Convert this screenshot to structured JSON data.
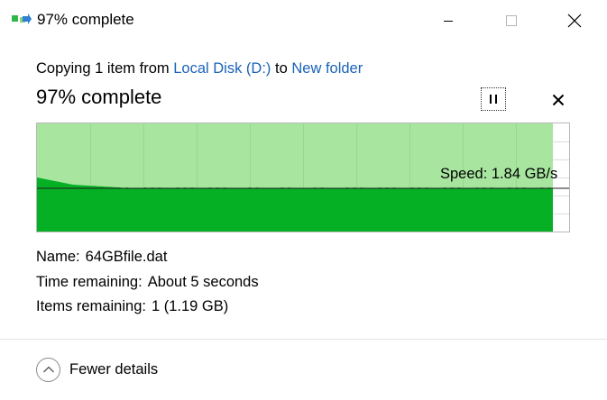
{
  "window": {
    "title": "97% complete"
  },
  "transfer": {
    "copying_prefix": "Copying 1 item from ",
    "source": "Local Disk (D:)",
    "to_word": " to ",
    "destination": "New folder",
    "percent_text": "97% complete",
    "progress_fraction": 0.97,
    "speed_text": "Speed: 1.84 GB/s"
  },
  "details": {
    "name_label": "Name:",
    "name_value": "64GBfile.dat",
    "time_label": "Time remaining:",
    "time_value": "About 5 seconds",
    "items_label": "Items remaining:",
    "items_value": "1 (1.19 GB)"
  },
  "footer": {
    "fewer_details_label": "Fewer details"
  },
  "colors": {
    "link": "#1a63b8",
    "graph_fill": "#06b025",
    "graph_bg_done": "#a8e6a0"
  }
}
